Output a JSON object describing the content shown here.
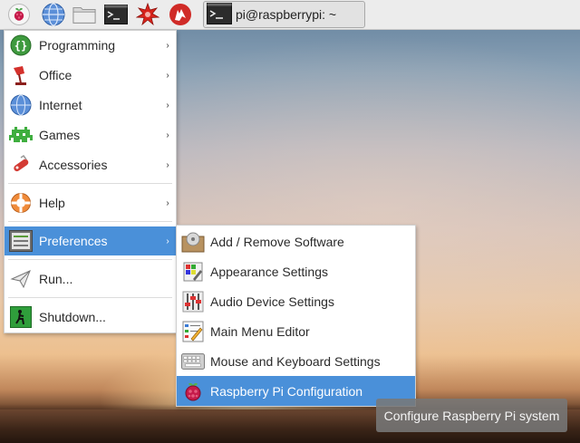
{
  "taskbar": {
    "launchers": [
      {
        "icon": "raspberry-menu-icon"
      },
      {
        "icon": "web-browser-icon"
      },
      {
        "icon": "file-manager-icon"
      },
      {
        "icon": "terminal-icon"
      },
      {
        "icon": "mathematica-icon"
      },
      {
        "icon": "wolfram-icon"
      }
    ],
    "task_window": {
      "icon": "terminal-icon",
      "label": "pi@raspberrypi: ~"
    }
  },
  "menu": {
    "items": [
      {
        "label": "Programming",
        "icon": "programming-icon",
        "has_submenu": true
      },
      {
        "label": "Office",
        "icon": "office-icon",
        "has_submenu": true
      },
      {
        "label": "Internet",
        "icon": "internet-icon",
        "has_submenu": true
      },
      {
        "label": "Games",
        "icon": "games-icon",
        "has_submenu": true
      },
      {
        "label": "Accessories",
        "icon": "accessories-icon",
        "has_submenu": true
      },
      {
        "label": "Help",
        "icon": "help-icon",
        "has_submenu": true
      },
      {
        "label": "Preferences",
        "icon": "preferences-icon",
        "has_submenu": true,
        "active": true
      },
      {
        "label": "Run...",
        "icon": "run-icon",
        "has_submenu": false
      },
      {
        "label": "Shutdown...",
        "icon": "shutdown-icon",
        "has_submenu": false
      }
    ],
    "arrow": "›"
  },
  "submenu": {
    "items": [
      {
        "label": "Add / Remove Software",
        "icon": "software-icon"
      },
      {
        "label": "Appearance Settings",
        "icon": "appearance-icon"
      },
      {
        "label": "Audio Device Settings",
        "icon": "audio-icon"
      },
      {
        "label": "Main Menu Editor",
        "icon": "menu-editor-icon"
      },
      {
        "label": "Mouse and Keyboard Settings",
        "icon": "keyboard-icon"
      },
      {
        "label": "Raspberry Pi Configuration",
        "icon": "raspberry-config-icon",
        "active": true
      }
    ]
  },
  "tooltip": {
    "text": "Configure Raspberry Pi system"
  },
  "colors": {
    "highlight": "#4a90d9",
    "panel": "#ececec",
    "menu_bg": "#ffffff"
  }
}
